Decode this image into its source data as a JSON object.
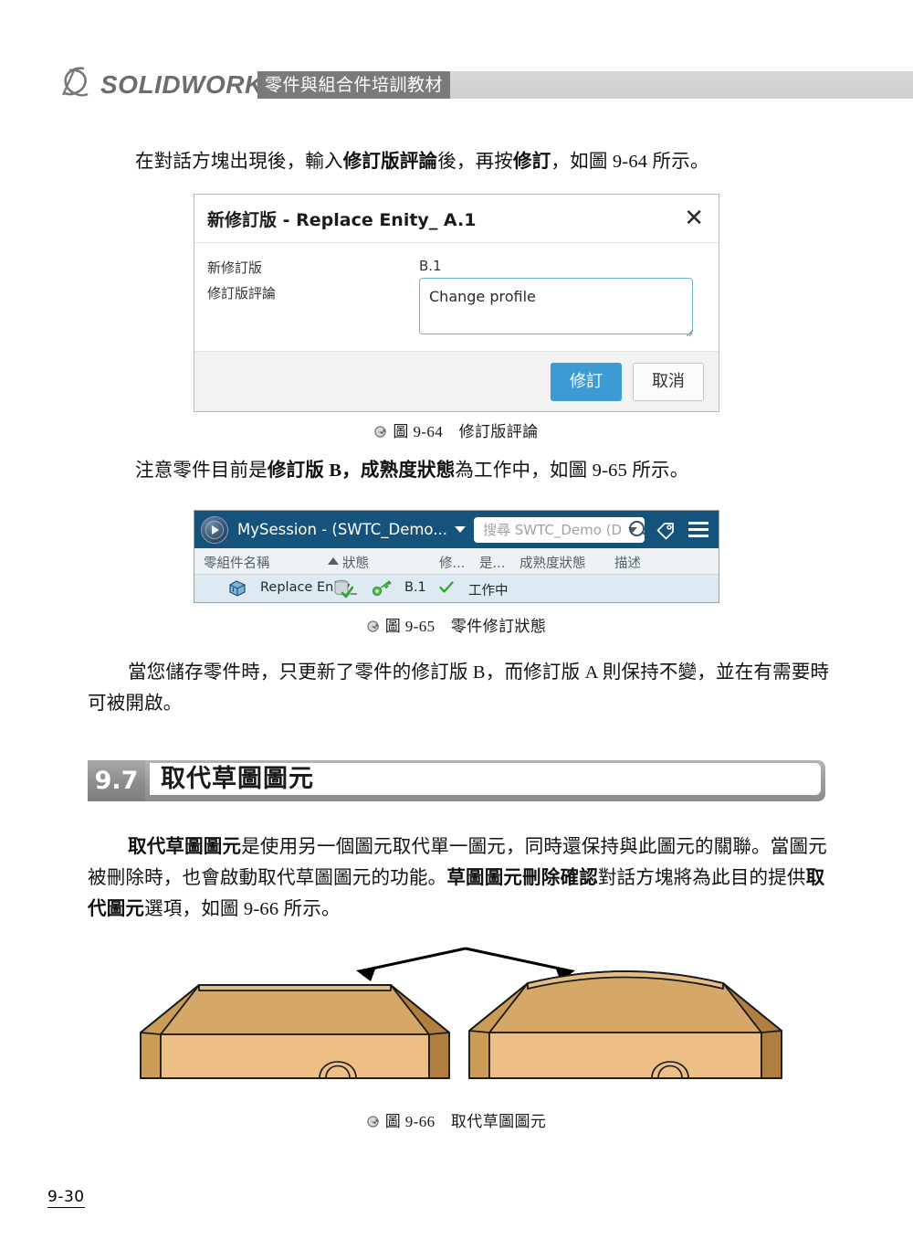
{
  "header": {
    "brand": "SOLIDWORKS",
    "book_title": "零件與組合件培訓教材",
    "logo_alt": "3DS"
  },
  "paragraphs": {
    "p1": "在對話方塊出現後，輸入",
    "p1_b1": "修訂版評論",
    "p1_mid": "後，再按",
    "p1_b2": "修訂",
    "p1_end": "，如圖 9-64 所示。",
    "p2_a": "注意零件目前是",
    "p2_b1": "修訂版 B",
    "p2_b": "，",
    "p2_b2": "成熟度狀態",
    "p2_c": "為工作中，如圖 9-65 所示。",
    "p3_line1": "當您儲存零件時，只更新了零件的修訂版 B，而修訂版 A 則保持不變，並在有需要時",
    "p3_line2": "可被開啟。",
    "p4_b1": "取代草圖圖元",
    "p4_t1": "是使用另一個圖元取代單一圖元，同時還保持與此圖元的關聯。當圖元",
    "p4_t2": "被刪除時，也會啟動取代草圖圖元的功能。",
    "p4_b2": "草圖圖元刪除確認",
    "p4_t3": "對話方塊將為此目的提供",
    "p4_b3": "取",
    "p4_b4": "代圖元",
    "p4_t4": "選項，如圖 9-66 所示。"
  },
  "dialog": {
    "title": "新修訂版 - Replace Enity_ A.1",
    "close_icon": "close-icon",
    "label_new_revision": "新修訂版",
    "value_new_revision": "B.1",
    "label_comment": "修訂版評論",
    "comment_value": "Change profile",
    "comment_placeholder": "",
    "btn_ok": "修訂",
    "btn_cancel": "取消",
    "accent_color": "#3d9bd4"
  },
  "panel": {
    "session_title": "MySession - (SWTC_Demo...",
    "search_placeholder": "搜尋 SWTC_Demo (DS...",
    "top_bar_color": "#15527c",
    "icons": {
      "compass": "compass-icon",
      "dropdown": "chevron-down-icon",
      "search": "search-icon",
      "tag": "tag-icon",
      "menu": "hamburger-menu-icon"
    },
    "columns": [
      "零組件名稱",
      "狀態",
      "修...",
      "是...",
      "成熟度狀態",
      "描述"
    ],
    "sort_indicator": "▲",
    "row": {
      "name": "Replace Enity_",
      "revision": "B.1",
      "maturity": "工作中",
      "description": "",
      "status_icon": "database-check-icon",
      "lock_icon": "key-icon",
      "part_icon": "part-icon",
      "check_icon": "check-icon"
    }
  },
  "captions": {
    "fig964": "圖 9-64　修訂版評論",
    "fig965": "圖 9-65　零件修訂狀態",
    "fig966": "圖 9-66　取代草圖圖元"
  },
  "section": {
    "number": "9.7",
    "title": "取代草圖圖元"
  },
  "figure_966": {
    "left_shape_label": "",
    "right_shape_label": "",
    "body_color": "#e0b072",
    "shade_color": "#c99a59",
    "dark_color": "#b07f3f"
  },
  "footer": {
    "page_number": "9-30"
  }
}
